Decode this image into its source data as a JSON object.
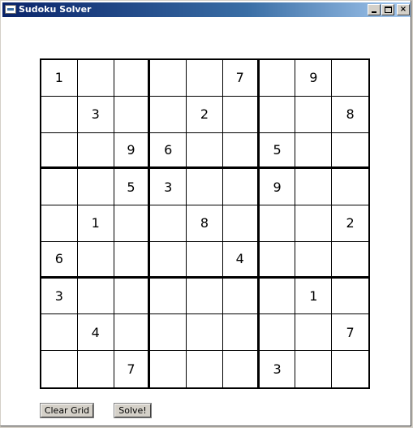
{
  "window": {
    "title": "Sudoku Solver",
    "icon": "app-window-icon",
    "controls": {
      "minimize": "_",
      "maximize": "□",
      "close": "×"
    }
  },
  "grid": {
    "rows": [
      [
        "1",
        "",
        "",
        "",
        "",
        "7",
        "",
        "9",
        ""
      ],
      [
        "",
        "3",
        "",
        "",
        "2",
        "",
        "",
        "",
        "8"
      ],
      [
        "",
        "",
        "9",
        "6",
        "",
        "",
        "5",
        "",
        ""
      ],
      [
        "",
        "",
        "5",
        "3",
        "",
        "",
        "9",
        "",
        ""
      ],
      [
        "",
        "1",
        "",
        "",
        "8",
        "",
        "",
        "",
        "2"
      ],
      [
        "6",
        "",
        "",
        "",
        "",
        "4",
        "",
        "",
        ""
      ],
      [
        "3",
        "",
        "",
        "",
        "",
        "",
        "",
        "1",
        ""
      ],
      [
        "",
        "4",
        "",
        "",
        "",
        "",
        "",
        "",
        "7"
      ],
      [
        "",
        "",
        "7",
        "",
        "",
        "",
        "3",
        "",
        ""
      ]
    ]
  },
  "buttons": {
    "clear_label": "Clear Grid",
    "solve_label": "Solve!"
  },
  "colors": {
    "titlebar_start": "#0a246a",
    "titlebar_end": "#a6caf0",
    "background": "#ffffff",
    "button_face": "#d4d0c8"
  }
}
